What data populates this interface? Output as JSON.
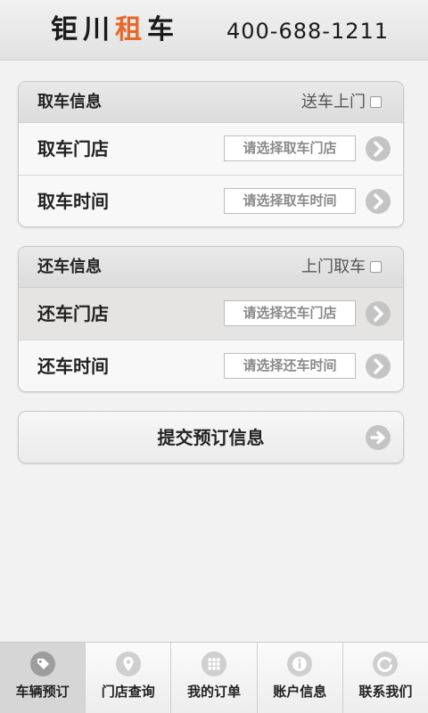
{
  "header": {
    "brand_prefix": "钜川",
    "brand_highlight": "租",
    "brand_suffix": "车",
    "phone": "400-688-1211"
  },
  "pickup": {
    "title": "取车信息",
    "option_label": "送车上门",
    "store_label": "取车门店",
    "store_placeholder": "请选择取车门店",
    "time_label": "取车时间",
    "time_placeholder": "请选择取车时间"
  },
  "return": {
    "title": "还车信息",
    "option_label": "上门取车",
    "store_label": "还车门店",
    "store_placeholder": "请选择还车门店",
    "time_label": "还车时间",
    "time_placeholder": "请选择还车时间"
  },
  "submit": {
    "label": "提交预订信息"
  },
  "tabs": [
    {
      "label": "车辆预订",
      "icon": "tag-icon"
    },
    {
      "label": "门店查询",
      "icon": "map-pin-icon"
    },
    {
      "label": "我的订单",
      "icon": "grid-icon"
    },
    {
      "label": "账户信息",
      "icon": "info-icon"
    },
    {
      "label": "联系我们",
      "icon": "refresh-icon"
    }
  ],
  "colors": {
    "brand_accent": "#e8682a",
    "active_tab": "#d6d6d6",
    "arrow_circle": "#c4c4c4"
  }
}
